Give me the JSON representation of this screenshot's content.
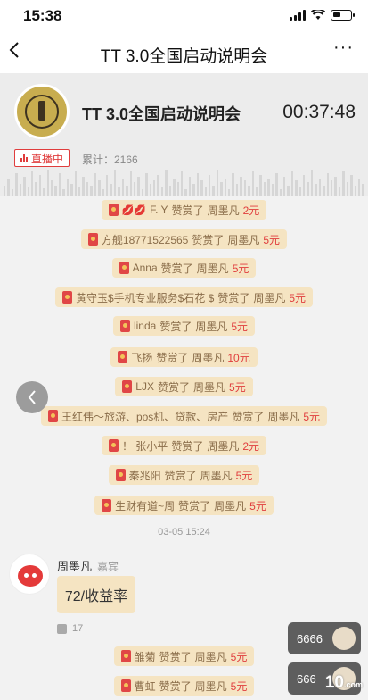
{
  "status_bar": {
    "time": "15:38"
  },
  "nav": {
    "back_icon": "chevron-left-icon",
    "title": "TT 3.0全国启动说明会",
    "more": "···"
  },
  "header": {
    "title": "TT 3.0全国启动说明会",
    "timer": "00:37:48",
    "live_badge": "直播中",
    "count": "累计：2166"
  },
  "tips": [
    {
      "name_prefix_icon": "lips-icon",
      "user": "F. Y",
      "action": "赞赏了",
      "target": "周墨凡",
      "amount": "2元"
    },
    {
      "user": "方舰18771522565",
      "action": "赞赏了",
      "target": "周墨凡",
      "amount": "5元"
    },
    {
      "user": "Anna",
      "action": "赞赏了",
      "target": "周墨凡",
      "amount": "5元"
    },
    {
      "user": "黄守玉$手机专业服务$石花 $",
      "action": "赞赏了",
      "target": "周墨凡",
      "amount": "5元"
    },
    {
      "user": "linda",
      "action": "赞赏了",
      "target": "周墨凡",
      "amount": "5元"
    },
    {
      "user": "飞扬",
      "action": "赞赏了",
      "target": "周墨凡",
      "amount": "10元"
    },
    {
      "user": "LJX",
      "action": "赞赏了",
      "target": "周墨凡",
      "amount": "5元"
    },
    {
      "user": "王红伟～旅游、pos机、贷款、房产",
      "action": "赞赏了",
      "target": "周墨凡",
      "amount": "5元"
    },
    {
      "user": "！ 张小平",
      "action": "赞赏了",
      "target": "周墨凡",
      "amount": "2元"
    },
    {
      "user": "秦兆阳",
      "action": "赞赏了",
      "target": "周墨凡",
      "amount": "5元"
    },
    {
      "user": "生财有道~周",
      "action": "赞赏了",
      "target": "周墨凡",
      "amount": "5元"
    }
  ],
  "timestamp": "03-05 15:24",
  "message": {
    "sender": "周墨凡",
    "role": "嘉宾",
    "text": "72/收益率",
    "likes": "17"
  },
  "tips_after": [
    {
      "user": "雏菊",
      "action": "赞赏了",
      "target": "周墨凡",
      "amount": "5元"
    },
    {
      "user": "曹虹",
      "action": "赞赏了",
      "target": "周墨凡",
      "amount": "5元"
    }
  ],
  "viewers": [
    {
      "text": "6666"
    },
    {
      "text": "666"
    }
  ],
  "watermark": {
    "text": "10",
    "suffix": ".com"
  },
  "colors": {
    "accent": "#e03d3d",
    "pill_bg": "#f5e4c2",
    "envelope": "#e04646"
  }
}
